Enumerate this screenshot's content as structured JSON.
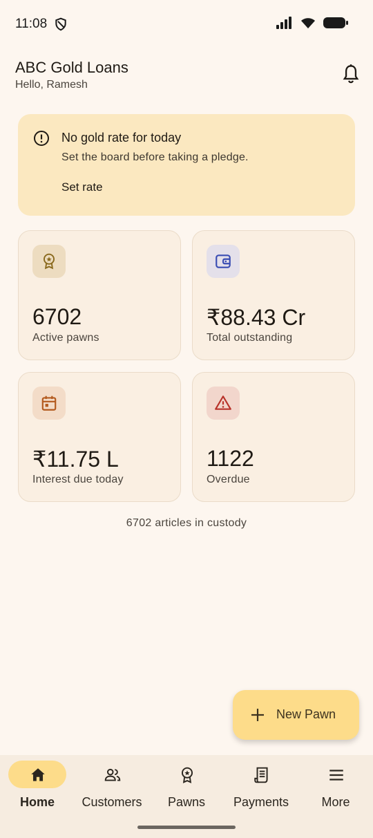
{
  "status_bar": {
    "time": "11:08"
  },
  "header": {
    "title": "ABC Gold Loans",
    "greeting": "Hello, Ramesh"
  },
  "alert": {
    "title": "No gold rate for today",
    "subtitle": "Set the board before taking a pledge.",
    "action": "Set rate"
  },
  "stats": [
    {
      "value": "6702",
      "label": "Active pawns",
      "icon": "medal-icon",
      "icon_color": "#8a6a1e",
      "icon_bg": "#eddcc0"
    },
    {
      "value": "₹88.43 Cr",
      "label": "Total outstanding",
      "icon": "wallet-icon",
      "icon_color": "#3a4db3",
      "icon_bg": "#e4e0ea"
    },
    {
      "value": "₹11.75 L",
      "label": "Interest due today",
      "icon": "calendar-icon",
      "icon_color": "#b35a1e",
      "icon_bg": "#f3dcc8"
    },
    {
      "value": "1122",
      "label": "Overdue",
      "icon": "warning-icon",
      "icon_color": "#b8322a",
      "icon_bg": "#f2d6cc"
    }
  ],
  "custody_note": "6702 articles in custody",
  "fab": {
    "label": "New Pawn"
  },
  "nav": [
    {
      "label": "Home",
      "icon": "home-icon",
      "active": true
    },
    {
      "label": "Customers",
      "icon": "people-icon",
      "active": false
    },
    {
      "label": "Pawns",
      "icon": "medal-icon",
      "active": false
    },
    {
      "label": "Payments",
      "icon": "receipt-icon",
      "active": false
    },
    {
      "label": "More",
      "icon": "menu-icon",
      "active": false
    }
  ],
  "colors": {
    "background": "#fdf6ef",
    "alert_bg": "#fbe8c0",
    "accent": "#fddc8a"
  }
}
